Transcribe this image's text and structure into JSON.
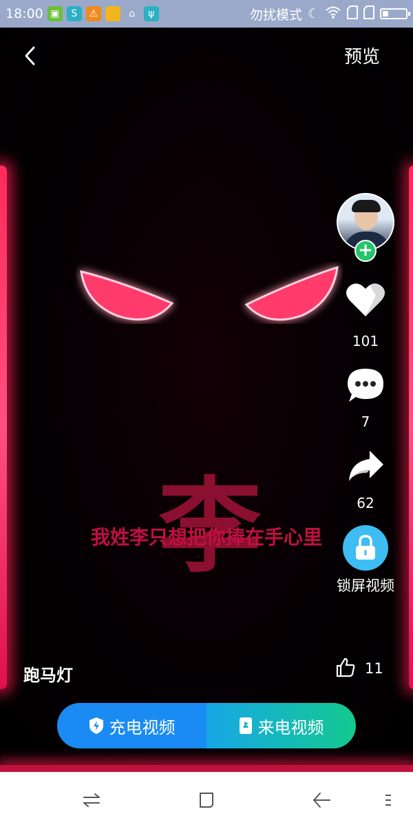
{
  "status_bar": {
    "time": "18:00",
    "mode_text": "勿扰模式"
  },
  "header": {
    "preview_label": "预览"
  },
  "video": {
    "big_char": "李",
    "overlay_text": "我姓李只想把你捧在手心里"
  },
  "side": {
    "like_count": "101",
    "comment_count": "7",
    "share_count": "62",
    "lock_label": "锁屏视频"
  },
  "content": {
    "title": "跑马灯",
    "thumb_count": "11"
  },
  "actions": {
    "charge_label": "充电视频",
    "call_label": "来电视频"
  },
  "colors": {
    "accent_blue": "#1a8bf2",
    "accent_green": "#14c98f",
    "neon": "#ff2a5a"
  }
}
